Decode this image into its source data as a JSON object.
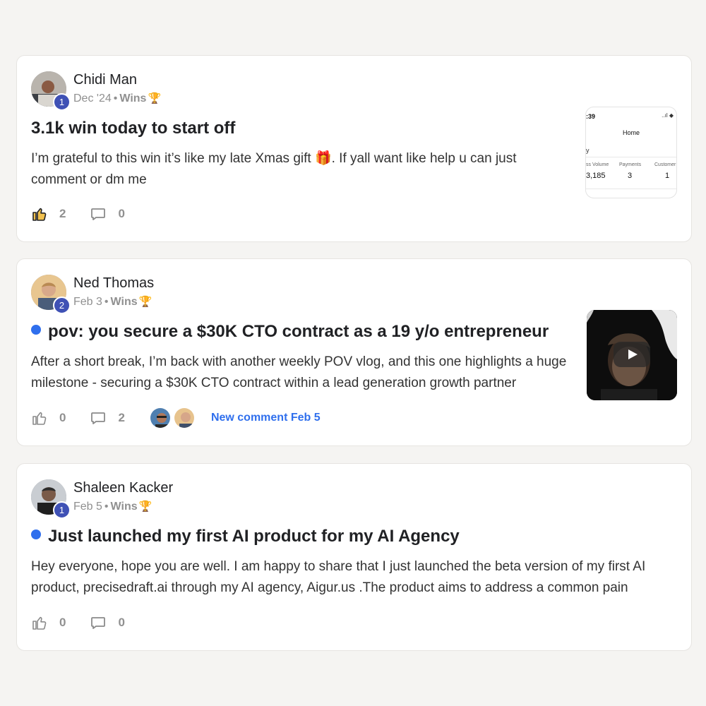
{
  "posts": [
    {
      "author": "Chidi Man",
      "level": "1",
      "date": "Dec '24",
      "category": "Wins",
      "title": "3.1k win today to start off",
      "unread": false,
      "body": "I’m grateful to this win it’s like my late Xmas gift 🎁. If yall want like help u can just comment or dm me",
      "likes": "2",
      "comments": "0",
      "thumbnail": {
        "time": ":39",
        "status": "..ıl ◆",
        "screen_title": "Home",
        "letter": "y",
        "columns": [
          "ss Volume",
          "Payments",
          "Customer"
        ],
        "values": [
          "3,185",
          "3",
          "1"
        ]
      }
    },
    {
      "author": "Ned Thomas",
      "level": "2",
      "date": "Feb 3",
      "category": "Wins",
      "title": "pov: you secure a $30K CTO contract as a 19 y/o entrepreneur",
      "unread": true,
      "body": "After a short break, I’m back with another weekly POV vlog, and this one highlights a huge milestone - securing a $30K CTO contract within a lead generation growth partner",
      "likes": "0",
      "comments": "2",
      "new_comment": "New comment Feb 5",
      "thumbnail_icon": "video-play-icon"
    },
    {
      "author": "Shaleen Kacker",
      "level": "1",
      "date": "Feb 5",
      "category": "Wins",
      "title": "Just launched my first AI product for my AI Agency",
      "unread": true,
      "body": "Hey everyone, hope you are well. I am happy to share that I just launched the beta version of my first AI product, precisedraft.ai through my AI agency, Aigur.us .The product aims to address a common pain",
      "likes": "0",
      "comments": "0"
    }
  ],
  "colors": {
    "accent": "#2f6fed",
    "badge": "#3f51b5",
    "background": "#f5f4f2",
    "muted": "#909090"
  }
}
